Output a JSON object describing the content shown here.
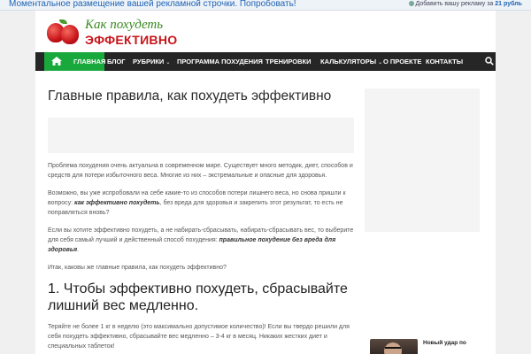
{
  "ad_bar": {
    "text": "Моментальное размещение вашей рекламной строчки. Попробовать!",
    "add_prefix": "Добавить вашу рекламу за",
    "add_price": "21 рубль"
  },
  "logo": {
    "line1": "Как похудеть",
    "line2": "ЭФФЕКТИВНО"
  },
  "nav": {
    "items": [
      {
        "label": "Главная"
      },
      {
        "label": "Блог"
      },
      {
        "label": "Рубрики"
      },
      {
        "label": "Программа похудения"
      },
      {
        "label": "Тренировки"
      },
      {
        "label": "Калькуляторы"
      },
      {
        "label": "О проекте"
      },
      {
        "label": "Контакты"
      }
    ],
    "chevron": "⌄",
    "accent_color": "#19a83c"
  },
  "article": {
    "title": "Главные правила, как похудеть эффективно",
    "p1": "Проблема похудения очень актуальна в современном мире. Существует много методик, диет, способов и средств для потери избыточного веса. Многие из них – экстремальные и опасные для здоровья.",
    "p2_start": "Возможно, вы уже испробовали на себе какие-то из способов потери лишнего веса, но снова пришли к вопросу: ",
    "p2_bold": "как эффективно похудеть",
    "p2_end": ", без вреда для здоровья и закрепить этот результат, то есть не поправляться вновь?",
    "p3_start": "Если вы хотите эффективно похудеть, а не набирать-сбрасывать, набирать-сбрасывать вес, то выберите для себя самый лучший и действенный способ похудения: ",
    "p3_bold": "правильное похудение без вреда для здоровья",
    "p3_end": ".",
    "p4": "Итак, каковы же главные правила, как похудеть эффективно?",
    "h2": "1. Чтобы эффективно похудеть, сбрасывайте лишний вес медленно.",
    "p5": "Теряйте не более 1 кг в неделю (это максимально допустимое количество)! Если вы твердо решили для себя похудеть эффективно, сбрасывайте вес медленно – 3-4 кг в месяц. Никаких жестких диет и специальных таблеток!"
  },
  "sidebar": {
    "caption": "Новый удар по"
  }
}
